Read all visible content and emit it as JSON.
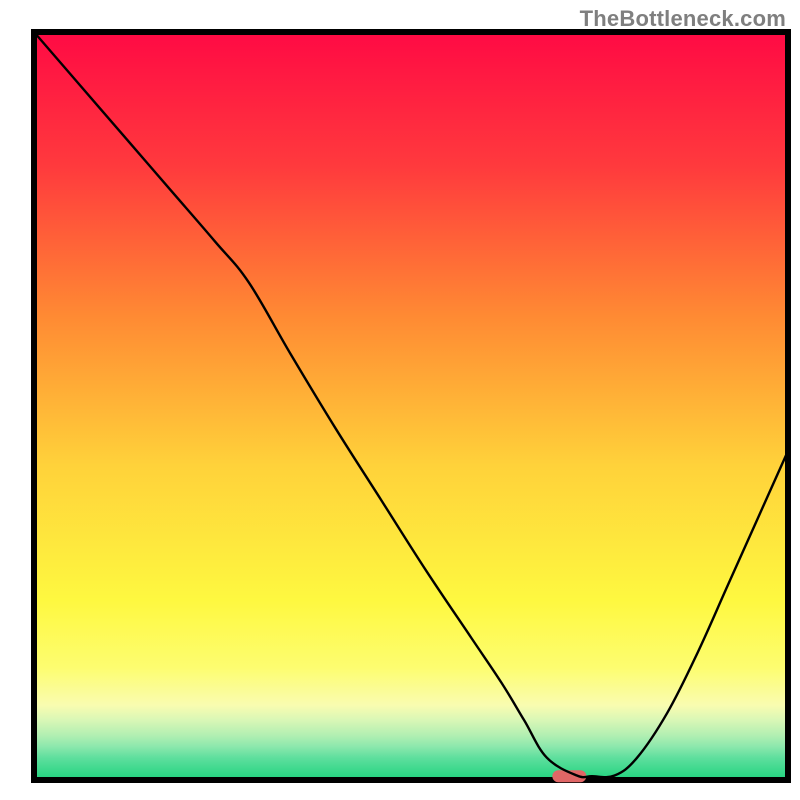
{
  "watermark": "TheBottleneck.com",
  "axis_color": "#000000",
  "chart_data": {
    "type": "line",
    "title": "",
    "xlabel": "",
    "ylabel": "",
    "xlim": [
      0,
      100
    ],
    "ylim": [
      0,
      100
    ],
    "annotations": [
      {
        "type": "marker",
        "shape": "rounded-rect",
        "x": 71,
        "y": 0.5,
        "color": "#e06666"
      }
    ],
    "background": {
      "type": "vertical-gradient",
      "stops": [
        {
          "pos": 0.0,
          "color": "#ff0a44"
        },
        {
          "pos": 0.18,
          "color": "#ff3a3d"
        },
        {
          "pos": 0.38,
          "color": "#ff8a33"
        },
        {
          "pos": 0.58,
          "color": "#ffd23a"
        },
        {
          "pos": 0.76,
          "color": "#fef840"
        },
        {
          "pos": 0.85,
          "color": "#fdfd70"
        },
        {
          "pos": 0.9,
          "color": "#f9fcb0"
        },
        {
          "pos": 0.92,
          "color": "#d9f7b6"
        },
        {
          "pos": 0.94,
          "color": "#b2efb2"
        },
        {
          "pos": 0.955,
          "color": "#8de8ad"
        },
        {
          "pos": 0.97,
          "color": "#5fdf9e"
        },
        {
          "pos": 1.0,
          "color": "#20d37e"
        }
      ]
    },
    "series": [
      {
        "name": "bottleneck-curve",
        "color": "#000000",
        "stroke_width": 2.4,
        "x": [
          0,
          6,
          12,
          18,
          24,
          28.5,
          34,
          40,
          46,
          52,
          58,
          62,
          65,
          68,
          72,
          74,
          77,
          80,
          84,
          88,
          92,
          96,
          100
        ],
        "y": [
          100,
          93,
          86,
          79,
          72,
          66.5,
          57,
          47,
          37.5,
          28,
          19,
          13,
          8,
          3,
          0.6,
          0.5,
          0.6,
          3,
          9,
          17,
          26,
          35,
          44
        ]
      }
    ]
  }
}
